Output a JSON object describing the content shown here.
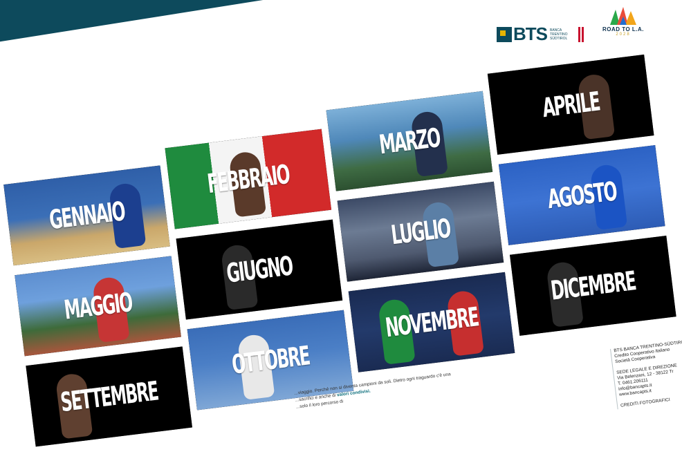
{
  "brand": {
    "bts_name": "BTS",
    "bts_sub": "BANCA TRENTINO SÜDTIROL",
    "bts_tagline": "GRUPPO COOPERATIVO ITALIANO",
    "road_title": "ROAD TO L.A.",
    "road_year": "2028",
    "colors": {
      "teal": "#0d4a5c",
      "gold": "#e7b400",
      "red": "#c8102e"
    }
  },
  "months": [
    {
      "label": "GENNAIO"
    },
    {
      "label": "FEBBRAIO"
    },
    {
      "label": "MARZO"
    },
    {
      "label": "APRILE"
    },
    {
      "label": "MAGGIO"
    },
    {
      "label": "GIUGNO"
    },
    {
      "label": "LUGLIO"
    },
    {
      "label": "AGOSTO"
    },
    {
      "label": "SETTEMBRE"
    },
    {
      "label": "OTTOBRE"
    },
    {
      "label": "NOVEMBRE"
    },
    {
      "label": "DICEMBRE"
    }
  ],
  "footer": {
    "line1": "...viaggio. Perché non si diventa campioni da soli. Dietro ogni traguardo c'è una",
    "line2": "...sacrifici e anche di",
    "line2_strong": "valori condivisi.",
    "line3": "...solo il loro percorso di"
  },
  "contacts": {
    "company": "BTS BANCA TRENTINO-SÜDTIROL",
    "company2": "Credito Cooperativo Italiano",
    "company3": "Società Cooperativa",
    "hq_title": "SEDE LEGALE E DIREZIONE",
    "address": "Via Belenzani, 12 - 38122 Tr",
    "phone": "T. 0461.206111",
    "email": "info@bancapts.it",
    "web": "www.bancapts.it",
    "credits": "CREDITI FOTOGRAFICI"
  }
}
